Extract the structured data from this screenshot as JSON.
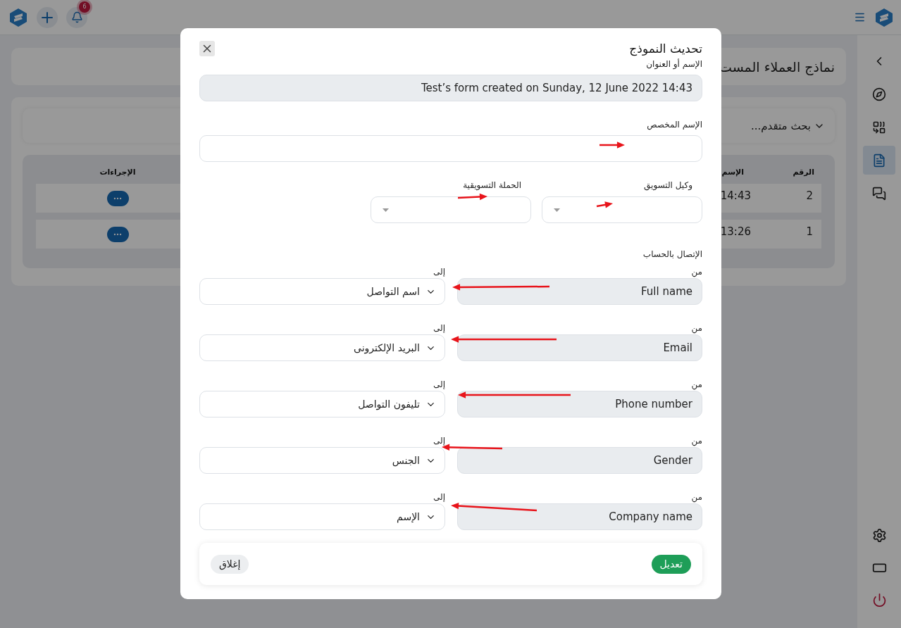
{
  "top_bar": {
    "notification_count": "6"
  },
  "sidebar": {
    "items": [
      {
        "kind": "back",
        "selected": false
      },
      {
        "kind": "compass",
        "selected": false
      },
      {
        "kind": "combine",
        "selected": false
      },
      {
        "kind": "document",
        "selected": true
      },
      {
        "kind": "chat",
        "selected": false
      }
    ],
    "bottom_items": [
      {
        "kind": "settings"
      },
      {
        "kind": "screen"
      },
      {
        "kind": "power"
      }
    ]
  },
  "page": {
    "title": "نماذج العملاء المست",
    "advanced_search": "بحث متقدم...",
    "table": {
      "columns": [
        "الرقم",
        "الإسم",
        "الإجراءات"
      ],
      "rows": [
        {
          "number": "2",
          "name": "14:43"
        },
        {
          "number": "1",
          "name": "13:26"
        }
      ]
    }
  },
  "dialog": {
    "title": "تحديث النموذج",
    "fields": [
      {
        "label": "الإسم أو العنوان",
        "value": "Test’s form created on Sunday, 12 June 2022 14:43",
        "disabled": true
      },
      {
        "label": "الإسم المخصص",
        "disabled": false
      }
    ],
    "selects": [
      {
        "label": "وكيل التسويق"
      },
      {
        "label": "الحملة التسويقية"
      }
    ],
    "mapping": {
      "title": "الإتصال بالحساب",
      "rows": [
        {
          "from_label": "من",
          "from": "Full name",
          "to_label": "إلى",
          "to": "اسم التواصل"
        },
        {
          "from_label": "من",
          "from": "Email",
          "to_label": "إلى",
          "to": "البريد الإلكترونى"
        },
        {
          "from_label": "من",
          "from": "Phone number",
          "to_label": "إلى",
          "to": "تليفون التواصل"
        },
        {
          "from_label": "من",
          "from": "Gender",
          "to_label": "إلى",
          "to": "الجنس"
        },
        {
          "from_label": "من",
          "from": "Company name",
          "to_label": "إلى",
          "to": "الإسم"
        }
      ]
    },
    "buttons": [
      {
        "kind": "primary",
        "label": "تعديل"
      },
      {
        "kind": "secondary",
        "label": "إغلاق"
      }
    ]
  }
}
